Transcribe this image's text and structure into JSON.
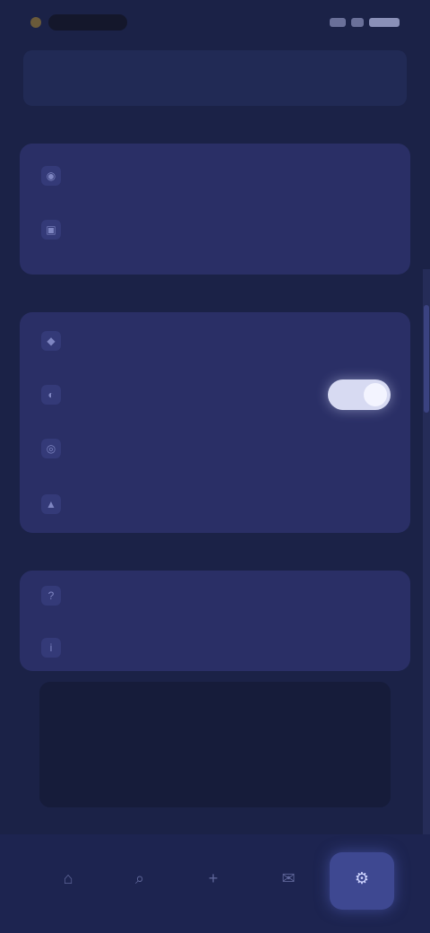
{
  "status_bar": {
    "icons": [
      "app-badge-icon",
      "signal-icon",
      "wifi-icon",
      "battery-icon"
    ]
  },
  "header": {
    "title": "",
    "subtitle": ""
  },
  "sections": [
    {
      "rows": [
        {
          "icon": "user-icon",
          "glyph": "◉",
          "label": ""
        },
        {
          "icon": "lock-icon",
          "glyph": "▣",
          "label": ""
        }
      ]
    },
    {
      "rows": [
        {
          "icon": "bell-icon",
          "glyph": "◆",
          "label": ""
        },
        {
          "icon": "moon-icon",
          "glyph": "◐",
          "label": "",
          "toggle_on": true
        },
        {
          "icon": "globe-icon",
          "glyph": "◎",
          "label": ""
        },
        {
          "icon": "shield-icon",
          "glyph": "▲",
          "label": ""
        }
      ]
    },
    {
      "rows": [
        {
          "icon": "help-icon",
          "glyph": "?",
          "label": ""
        },
        {
          "icon": "info-icon",
          "glyph": "i",
          "label": ""
        }
      ]
    }
  ],
  "info_panel": {
    "line1": "",
    "line2": ""
  },
  "bottom_nav": [
    {
      "icon": "home-icon",
      "glyph": "⌂",
      "label": ""
    },
    {
      "icon": "search-icon",
      "glyph": "⌕",
      "label": ""
    },
    {
      "icon": "plus-icon",
      "glyph": "+",
      "label": ""
    },
    {
      "icon": "chat-icon",
      "glyph": "✉",
      "label": ""
    },
    {
      "icon": "settings-icon",
      "glyph": "⚙",
      "label": "",
      "active": true
    }
  ],
  "colors": {
    "background": "#1b2247",
    "card": "#2a2f66",
    "accent": "#3e4891",
    "toggle_on": "#d7daf2"
  }
}
